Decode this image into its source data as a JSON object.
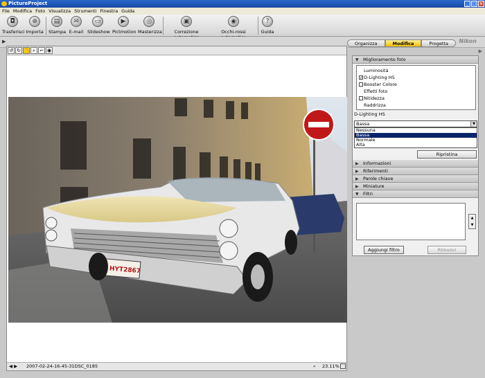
{
  "app": {
    "title": "PictureProject"
  },
  "menu": [
    "File",
    "Modifica",
    "Foto",
    "Visualizza",
    "Strumenti",
    "Finestra",
    "Guida"
  ],
  "toolbar": {
    "trasferisci": "Trasferisci",
    "importa": "Importa",
    "stampa": "Stampa",
    "email": "E-mail",
    "slideshow": "Slideshow",
    "pictmotion": "Pictmotion",
    "masterizza": "Masterizza",
    "correzione": "Correzione automatica",
    "occhi_rossi": "Occhi-rossi automatico",
    "guida": "Guida"
  },
  "tabs": {
    "organizza": "Organizza",
    "modifica": "Modifica",
    "progetta": "Progetta"
  },
  "brand": "Nikon",
  "panel": {
    "miglioramento_title": "Miglioramento foto",
    "options": [
      {
        "label": "Luminosità",
        "checkbox": false,
        "checked": false
      },
      {
        "label": "D-Lighting HS",
        "checkbox": true,
        "checked": true
      },
      {
        "label": "Booster Colore",
        "checkbox": true,
        "checked": false
      },
      {
        "label": "Effetti foto",
        "checkbox": false,
        "checked": false
      },
      {
        "label": "Nitidezza",
        "checkbox": true,
        "checked": false
      },
      {
        "label": "Raddrizza",
        "checkbox": false,
        "checked": false
      }
    ],
    "setting_label": "D-Lighting HS",
    "select_value": "Bassa",
    "select_options": [
      "Nessuna",
      "Bassa",
      "Normale",
      "Alta"
    ],
    "selected_index": 1,
    "reset_button": "Ripristina",
    "sections": [
      "Informazioni",
      "Riferimenti",
      "Parole chiave",
      "Miniature",
      "Filtri"
    ],
    "add_filter_button": "Aggiungi filtro",
    "remove_button": "Rimuovi"
  },
  "status": {
    "filename": "2007-02-24-16-45-31DSC_0185",
    "zoom": "23.11%"
  },
  "colors": {
    "accent_tab": "#f0c000",
    "selection": "#0a246a",
    "title_bar": "#1f58b8"
  }
}
